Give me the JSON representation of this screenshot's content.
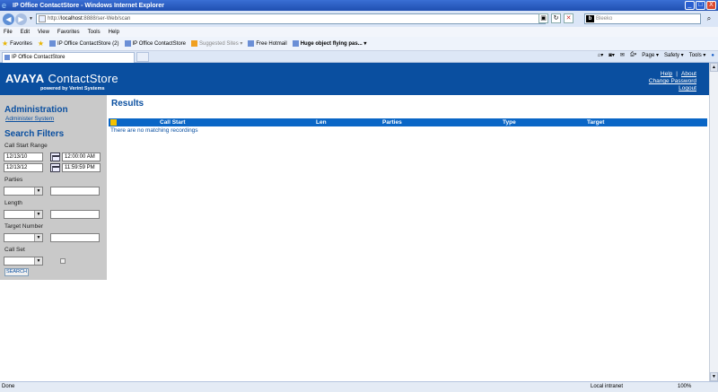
{
  "window": {
    "title": "IP Office ContactStore - Windows Internet Explorer",
    "buttons": [
      "_",
      "□",
      "X"
    ]
  },
  "address": {
    "url_prefix": "http://",
    "host": "localhost",
    "url_rest": ":8888/ser-Web/scan",
    "search_placeholder": "Bleeko"
  },
  "menu": [
    "File",
    "Edit",
    "View",
    "Favorites",
    "Tools",
    "Help"
  ],
  "favorites": {
    "label": "Favorites",
    "items": [
      {
        "label": "IP Office ContactStore (2)",
        "style": "normal"
      },
      {
        "label": "IP Office ContactStore",
        "style": "normal"
      },
      {
        "label": "Suggested Sites ▾",
        "style": "sugg"
      },
      {
        "label": "Free Hotmail",
        "style": "normal"
      },
      {
        "label": "Huge object flying pas... ▾",
        "style": "bold"
      }
    ]
  },
  "tab": {
    "label": "IP Office ContactStore"
  },
  "command_bar": [
    "Page ▾",
    "Safety ▾",
    "Tools ▾"
  ],
  "header": {
    "logo_brand": "AVAYA",
    "logo_product": "ContactStore",
    "powered": "powered by Verint Systems",
    "links": {
      "help": "Help",
      "about": "About",
      "change_password": "Change Password",
      "logout": "Logout"
    },
    "separator": "|"
  },
  "sidebar": {
    "admin_title": "Administration",
    "admin_link": "Administer System",
    "filters_title": "Search Filters",
    "call_start_range": "Call Start Range",
    "date_from": "12/13/10",
    "time_from": "12:00:00 AM",
    "date_to": "12/13/12",
    "time_to": "11:59:59 PM",
    "parties": "Parties",
    "length": "Length",
    "target_number": "Target Number",
    "call_set": "Call Set",
    "search_button": "SEARCH"
  },
  "results": {
    "title": "Results",
    "columns": [
      "Call Start",
      "Len",
      "Parties",
      "Type",
      "Target"
    ],
    "empty_message": "There are no matching recordings"
  },
  "status": {
    "left": "Done",
    "zone": "Local intranet",
    "zoom": "100%"
  },
  "colors": {
    "brand_blue": "#0a4fa0",
    "table_header": "#0a66c6",
    "sidebar_bg": "#c9c9c9"
  }
}
